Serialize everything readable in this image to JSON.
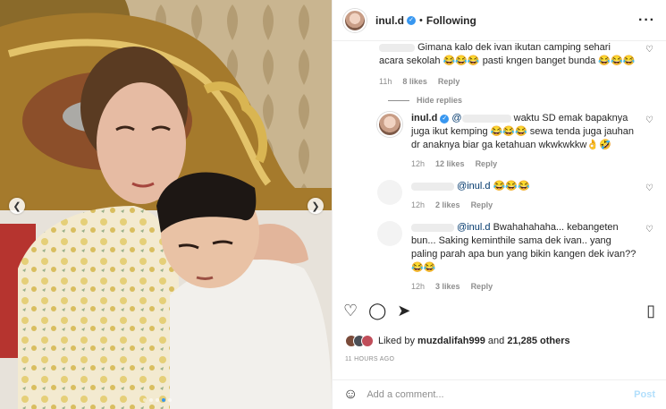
{
  "header": {
    "username": "inul.d",
    "separator": "•",
    "following_label": "Following",
    "more_icon": "more-horizontal-icon"
  },
  "photo": {
    "prev_icon": "chevron-left-icon",
    "next_icon": "chevron-right-icon",
    "current_slide": 4,
    "slide_count": 5
  },
  "comments": [
    {
      "text_prefix": "",
      "text": "Gimana kalo dek ivan ikutan camping sehari acara sekolah 😂😂😂 pasti kngen banget bunda 😂😂😂",
      "time": "11h",
      "likes": "8 likes",
      "reply": "Reply"
    },
    {
      "toggle": "Hide replies"
    },
    {
      "username": "inul.d",
      "mention": "@",
      "text": "waktu SD emak bapaknya juga ikut kemping 😂😂😂 sewa tenda juga jauhan dr anaknya biar ga ketahuan wkwkwkkw👌🤣",
      "time": "12h",
      "likes": "12 likes",
      "reply": "Reply"
    },
    {
      "mention": "@inul.d",
      "text": "😂😂😂",
      "time": "12h",
      "likes": "2 likes",
      "reply": "Reply"
    },
    {
      "mention": "@inul.d",
      "text_a": "Bwahahahaha...",
      "text": "kebangeten bun... Saking keminthile sama dek ivan.. yang paling parah apa bun yang bikin kangen dek ivan?? 😂😂",
      "time": "12h",
      "likes": "3 likes",
      "reply": "Reply"
    }
  ],
  "actions": {
    "like_icon": "heart-icon",
    "comment_icon": "comment-icon",
    "share_icon": "send-icon",
    "save_icon": "bookmark-icon"
  },
  "likes": {
    "prefix": "Liked by",
    "user": "muzdalifah999",
    "and": "and",
    "others": "21,285 others"
  },
  "date": "11 HOURS AGO",
  "add_comment": {
    "emoji_icon": "smile-icon",
    "placeholder": "Add a comment...",
    "post_label": "Post"
  },
  "colors": {
    "link": "#00376b",
    "accent": "#3897f0",
    "post_disabled": "#b2dffc",
    "muted": "#8e8e8e"
  }
}
